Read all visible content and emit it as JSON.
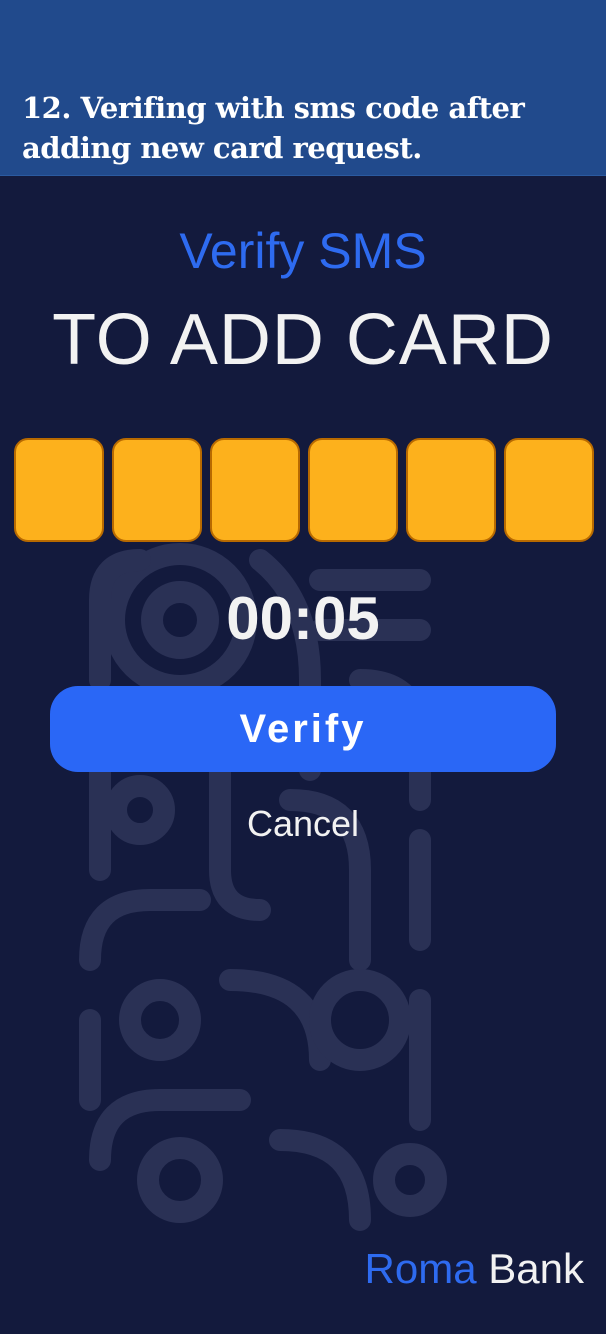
{
  "caption": {
    "text": "12. Verifing with sms code after adding new card request."
  },
  "header": {
    "subtitle": "Verify SMS",
    "title": "TO ADD CARD"
  },
  "code_inputs": [
    "",
    "",
    "",
    "",
    "",
    ""
  ],
  "timer": {
    "value": "00:05"
  },
  "actions": {
    "verify_label": "Verify",
    "cancel_label": "Cancel"
  },
  "brand": {
    "first": "Roma",
    "second": "Bank"
  },
  "colors": {
    "background": "#131a3d",
    "caption_bar": "#214a8c",
    "accent": "#2a67f6",
    "code_box": "#fdb11c",
    "text": "#f2f2f2"
  }
}
